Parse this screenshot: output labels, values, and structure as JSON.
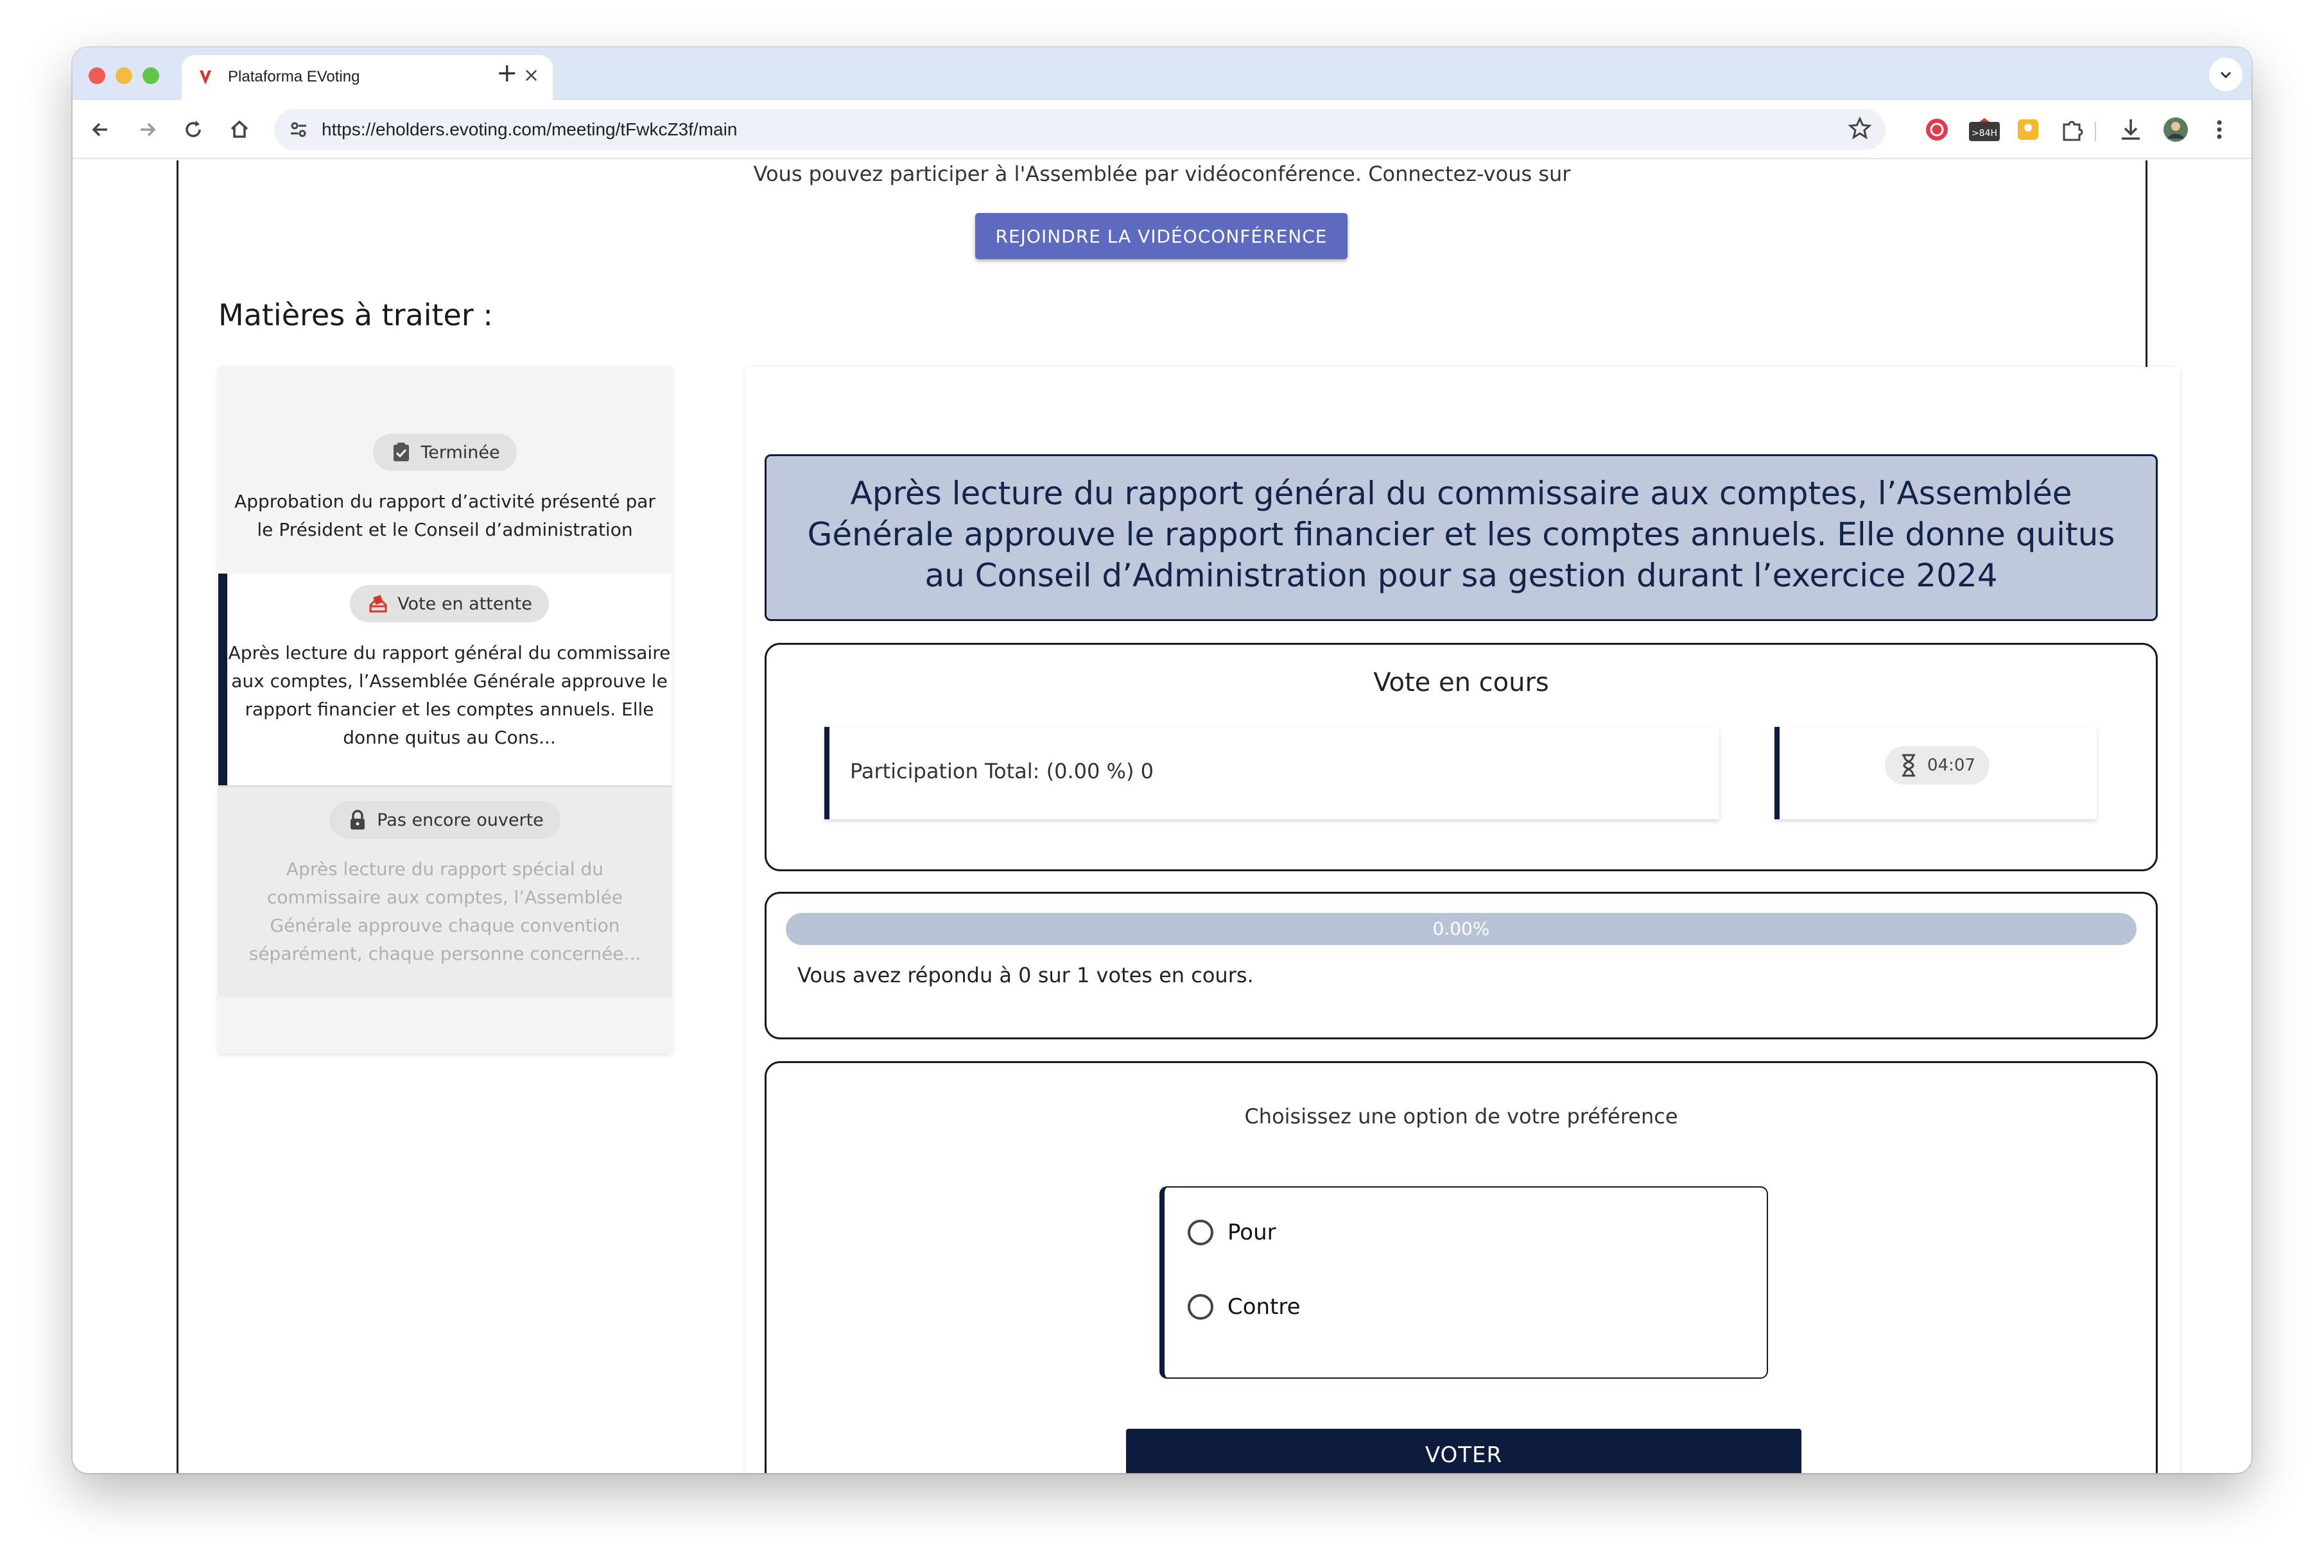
{
  "browser": {
    "tab_title": "Plataforma EVoting",
    "url": "https://eholders.evoting.com/meeting/tFwkcZ3f/main",
    "new_tab_symbol": "+",
    "tab_close_symbol": "×",
    "extension_badge": ">84H"
  },
  "page": {
    "intro_text": "Vous pouvez participer à l'Assemblée par vidéoconférence. Connectez-vous sur",
    "join_button": "REJOINDRE LA VIDÉOCONFÉRENCE",
    "section_title": "Matières à traiter :"
  },
  "items": [
    {
      "status": "Terminée",
      "status_icon": "clipboard-check-icon",
      "text": "Approbation du rapport d’activité présenté par le Président et le Conseil d’administration"
    },
    {
      "status": "Vote en attente",
      "status_icon": "ballot-box-icon",
      "text": "Après lecture du rapport général du commissaire aux comptes, l’Assemblée Générale approuve le rapport financier et les comptes annuels. Elle donne quitus au Cons..."
    },
    {
      "status": "Pas encore ouverte",
      "status_icon": "lock-icon",
      "text": "Après lecture du rapport spécial du commissaire aux comptes, l’Assemblée Générale approuve chaque convention séparément, chaque personne concernée..."
    }
  ],
  "question": {
    "text": "Après lecture du rapport général du commissaire aux comptes, l’Assemblée Générale approuve le rapport financier et les comptes annuels. Elle donne quitus au Conseil d’Administration pour sa gestion durant l’exercice 2024"
  },
  "vote_status": {
    "title": "Vote en cours",
    "participation": "Participation Total: (0.00 %) 0",
    "timer": "04:07"
  },
  "progress": {
    "value_percent": 0,
    "label": "0.00%",
    "note": "Vous avez répondu à 0 sur 1 votes en cours."
  },
  "vote_form": {
    "prompt": "Choisissez une option de votre préférence",
    "options": [
      "Pour",
      "Contre"
    ],
    "submit": "VOTER"
  },
  "colors": {
    "navy": "#0d1b3e",
    "join_button": "#5c6bc0",
    "question_bg": "#c0c9dc",
    "progress_track": "#b9c3d8"
  }
}
